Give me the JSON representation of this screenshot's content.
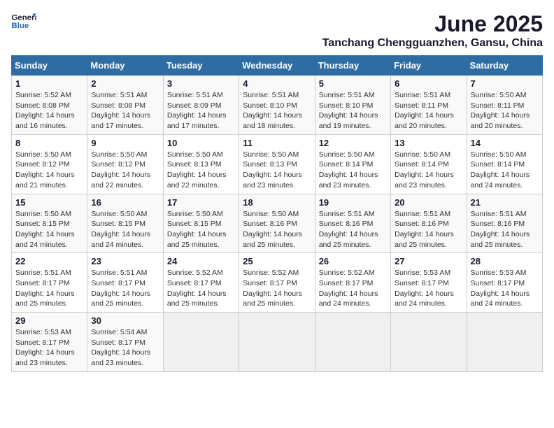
{
  "logo": {
    "line1": "General",
    "line2": "Blue"
  },
  "title": "June 2025",
  "location": "Tanchang Chengguanzhen, Gansu, China",
  "days_of_week": [
    "Sunday",
    "Monday",
    "Tuesday",
    "Wednesday",
    "Thursday",
    "Friday",
    "Saturday"
  ],
  "weeks": [
    [
      {
        "day": "1",
        "info": "Sunrise: 5:52 AM\nSunset: 8:08 PM\nDaylight: 14 hours\nand 16 minutes."
      },
      {
        "day": "2",
        "info": "Sunrise: 5:51 AM\nSunset: 8:08 PM\nDaylight: 14 hours\nand 17 minutes."
      },
      {
        "day": "3",
        "info": "Sunrise: 5:51 AM\nSunset: 8:09 PM\nDaylight: 14 hours\nand 17 minutes."
      },
      {
        "day": "4",
        "info": "Sunrise: 5:51 AM\nSunset: 8:10 PM\nDaylight: 14 hours\nand 18 minutes."
      },
      {
        "day": "5",
        "info": "Sunrise: 5:51 AM\nSunset: 8:10 PM\nDaylight: 14 hours\nand 19 minutes."
      },
      {
        "day": "6",
        "info": "Sunrise: 5:51 AM\nSunset: 8:11 PM\nDaylight: 14 hours\nand 20 minutes."
      },
      {
        "day": "7",
        "info": "Sunrise: 5:50 AM\nSunset: 8:11 PM\nDaylight: 14 hours\nand 20 minutes."
      }
    ],
    [
      {
        "day": "8",
        "info": "Sunrise: 5:50 AM\nSunset: 8:12 PM\nDaylight: 14 hours\nand 21 minutes."
      },
      {
        "day": "9",
        "info": "Sunrise: 5:50 AM\nSunset: 8:12 PM\nDaylight: 14 hours\nand 22 minutes."
      },
      {
        "day": "10",
        "info": "Sunrise: 5:50 AM\nSunset: 8:13 PM\nDaylight: 14 hours\nand 22 minutes."
      },
      {
        "day": "11",
        "info": "Sunrise: 5:50 AM\nSunset: 8:13 PM\nDaylight: 14 hours\nand 23 minutes."
      },
      {
        "day": "12",
        "info": "Sunrise: 5:50 AM\nSunset: 8:14 PM\nDaylight: 14 hours\nand 23 minutes."
      },
      {
        "day": "13",
        "info": "Sunrise: 5:50 AM\nSunset: 8:14 PM\nDaylight: 14 hours\nand 23 minutes."
      },
      {
        "day": "14",
        "info": "Sunrise: 5:50 AM\nSunset: 8:14 PM\nDaylight: 14 hours\nand 24 minutes."
      }
    ],
    [
      {
        "day": "15",
        "info": "Sunrise: 5:50 AM\nSunset: 8:15 PM\nDaylight: 14 hours\nand 24 minutes."
      },
      {
        "day": "16",
        "info": "Sunrise: 5:50 AM\nSunset: 8:15 PM\nDaylight: 14 hours\nand 24 minutes."
      },
      {
        "day": "17",
        "info": "Sunrise: 5:50 AM\nSunset: 8:15 PM\nDaylight: 14 hours\nand 25 minutes."
      },
      {
        "day": "18",
        "info": "Sunrise: 5:50 AM\nSunset: 8:16 PM\nDaylight: 14 hours\nand 25 minutes."
      },
      {
        "day": "19",
        "info": "Sunrise: 5:51 AM\nSunset: 8:16 PM\nDaylight: 14 hours\nand 25 minutes."
      },
      {
        "day": "20",
        "info": "Sunrise: 5:51 AM\nSunset: 8:16 PM\nDaylight: 14 hours\nand 25 minutes."
      },
      {
        "day": "21",
        "info": "Sunrise: 5:51 AM\nSunset: 8:16 PM\nDaylight: 14 hours\nand 25 minutes."
      }
    ],
    [
      {
        "day": "22",
        "info": "Sunrise: 5:51 AM\nSunset: 8:17 PM\nDaylight: 14 hours\nand 25 minutes."
      },
      {
        "day": "23",
        "info": "Sunrise: 5:51 AM\nSunset: 8:17 PM\nDaylight: 14 hours\nand 25 minutes."
      },
      {
        "day": "24",
        "info": "Sunrise: 5:52 AM\nSunset: 8:17 PM\nDaylight: 14 hours\nand 25 minutes."
      },
      {
        "day": "25",
        "info": "Sunrise: 5:52 AM\nSunset: 8:17 PM\nDaylight: 14 hours\nand 25 minutes."
      },
      {
        "day": "26",
        "info": "Sunrise: 5:52 AM\nSunset: 8:17 PM\nDaylight: 14 hours\nand 24 minutes."
      },
      {
        "day": "27",
        "info": "Sunrise: 5:53 AM\nSunset: 8:17 PM\nDaylight: 14 hours\nand 24 minutes."
      },
      {
        "day": "28",
        "info": "Sunrise: 5:53 AM\nSunset: 8:17 PM\nDaylight: 14 hours\nand 24 minutes."
      }
    ],
    [
      {
        "day": "29",
        "info": "Sunrise: 5:53 AM\nSunset: 8:17 PM\nDaylight: 14 hours\nand 23 minutes."
      },
      {
        "day": "30",
        "info": "Sunrise: 5:54 AM\nSunset: 8:17 PM\nDaylight: 14 hours\nand 23 minutes."
      },
      {
        "day": "",
        "info": ""
      },
      {
        "day": "",
        "info": ""
      },
      {
        "day": "",
        "info": ""
      },
      {
        "day": "",
        "info": ""
      },
      {
        "day": "",
        "info": ""
      }
    ]
  ]
}
